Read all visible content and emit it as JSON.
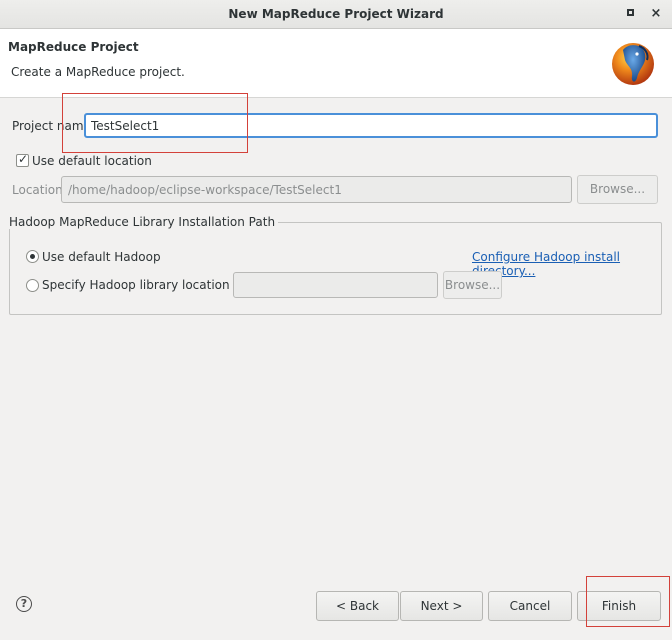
{
  "window": {
    "title": "New MapReduce Project Wizard",
    "minimize_glyph": "",
    "close_glyph": "×"
  },
  "header": {
    "title": "MapReduce Project",
    "description": "Create a MapReduce project."
  },
  "project_name": {
    "label": "Project name:",
    "value": "TestSelect1"
  },
  "default_location": {
    "label": "Use default location",
    "checked": true
  },
  "location": {
    "label": "Location:",
    "value": "/home/hadoop/eclipse-workspace/TestSelect1",
    "browse_label": "Browse..."
  },
  "hadoop_group": {
    "title": "Hadoop MapReduce Library Installation Path",
    "use_default_label": "Use default Hadoop",
    "configure_link": "Configure Hadoop install directory...",
    "specify_label": "Specify Hadoop library location",
    "library_value": "",
    "browse_label": "Browse...",
    "selected": "default"
  },
  "footer": {
    "help_glyph": "?",
    "back_label": "< Back",
    "next_label": "Next >",
    "cancel_label": "Cancel",
    "finish_label": "Finish"
  },
  "colors": {
    "accent": "#4a90d9",
    "link": "#1a5fb4",
    "annotation": "#d3413a"
  }
}
